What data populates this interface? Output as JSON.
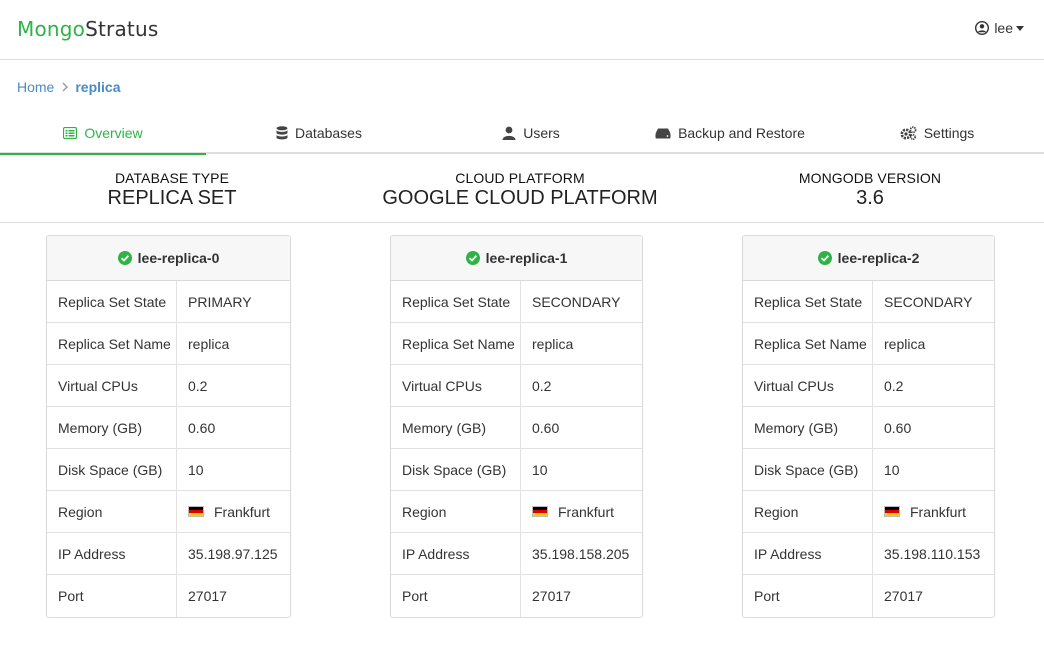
{
  "header": {
    "logo_part1": "Mongo",
    "logo_part2": "Stratus",
    "user": "lee"
  },
  "breadcrumb": {
    "home": "Home",
    "current": "replica"
  },
  "tabs": [
    {
      "label": "Overview",
      "icon": "list-icon",
      "active": true
    },
    {
      "label": "Databases",
      "icon": "database-icon"
    },
    {
      "label": "Users",
      "icon": "user-icon"
    },
    {
      "label": "Backup and Restore",
      "icon": "hdd-icon"
    },
    {
      "label": "Settings",
      "icon": "cogs-icon"
    }
  ],
  "summary": {
    "database_type": {
      "label": "DATABASE TYPE",
      "value": "REPLICA SET"
    },
    "cloud_platform": {
      "label": "CLOUD PLATFORM",
      "value": "GOOGLE CLOUD PLATFORM"
    },
    "mongodb_version": {
      "label": "MONGODB VERSION",
      "value": "3.6"
    }
  },
  "colors": {
    "brand_green": "#2fb347",
    "link_blue": "#4a8ac4",
    "flag_de": [
      "#000000",
      "#dd0000",
      "#ffce00"
    ]
  },
  "nodes": [
    {
      "name": "lee-replica-0",
      "status_icon": "check-circle-icon",
      "rows": [
        {
          "key": "Replica Set State",
          "value": "PRIMARY"
        },
        {
          "key": "Replica Set Name",
          "value": "replica"
        },
        {
          "key": "Virtual CPUs",
          "value": "0.2"
        },
        {
          "key": "Memory (GB)",
          "value": "0.60"
        },
        {
          "key": "Disk Space (GB)",
          "value": "10"
        },
        {
          "key": "Region",
          "value": "Frankfurt",
          "flag": "de-flag-icon"
        },
        {
          "key": "IP Address",
          "value": "35.198.97.125"
        },
        {
          "key": "Port",
          "value": "27017"
        }
      ]
    },
    {
      "name": "lee-replica-1",
      "status_icon": "check-circle-icon",
      "rows": [
        {
          "key": "Replica Set State",
          "value": "SECONDARY"
        },
        {
          "key": "Replica Set Name",
          "value": "replica"
        },
        {
          "key": "Virtual CPUs",
          "value": "0.2"
        },
        {
          "key": "Memory (GB)",
          "value": "0.60"
        },
        {
          "key": "Disk Space (GB)",
          "value": "10"
        },
        {
          "key": "Region",
          "value": "Frankfurt",
          "flag": "de-flag-icon"
        },
        {
          "key": "IP Address",
          "value": "35.198.158.205"
        },
        {
          "key": "Port",
          "value": "27017"
        }
      ]
    },
    {
      "name": "lee-replica-2",
      "status_icon": "check-circle-icon",
      "rows": [
        {
          "key": "Replica Set State",
          "value": "SECONDARY"
        },
        {
          "key": "Replica Set Name",
          "value": "replica"
        },
        {
          "key": "Virtual CPUs",
          "value": "0.2"
        },
        {
          "key": "Memory (GB)",
          "value": "0.60"
        },
        {
          "key": "Disk Space (GB)",
          "value": "10"
        },
        {
          "key": "Region",
          "value": "Frankfurt",
          "flag": "de-flag-icon"
        },
        {
          "key": "IP Address",
          "value": "35.198.110.153"
        },
        {
          "key": "Port",
          "value": "27017"
        }
      ]
    }
  ]
}
